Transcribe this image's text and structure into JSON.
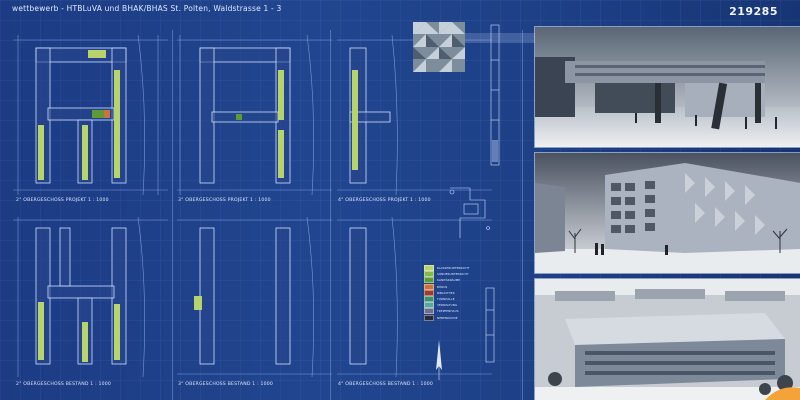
{
  "header": {
    "title": "wettbewerb - HTBLuVA und BHAK/BHAS St. Polten, Waldstrasse 1 - 3",
    "code": "219285"
  },
  "plans": [
    {
      "caption": "2° OBERGESCHOSS  PROJEKT     1 : 1000"
    },
    {
      "caption": "3° OBERGESCHOSS  PROJEKT     1 : 1000"
    },
    {
      "caption": "4° OBERGESCHOSS  PROJEKT     1 : 1000"
    },
    {
      "caption": "2° OBERGESCHOSS  BESTAND     1 : 1000"
    },
    {
      "caption": "3° OBERGESCHOSS  BESTAND     1 : 1000"
    },
    {
      "caption": "4° OBERGESCHOSS  BESTAND     1 : 1000"
    }
  ],
  "legend": {
    "items": [
      {
        "label": "KLASSENUNTERRICHT",
        "color": "#b7d36b"
      },
      {
        "label": "SONDERUNTERRICHT",
        "color": "#86b84d"
      },
      {
        "label": "SANITÄRRÄUME",
        "color": "#5f9a3a"
      },
      {
        "label": "BÜROS",
        "color": "#c8743a"
      },
      {
        "label": "BIBLIOTHEK",
        "color": "#9c3b2e"
      },
      {
        "label": "TURNHALLE",
        "color": "#3f8f6a"
      },
      {
        "label": "VERWALTUNG",
        "color": "#58a8a0"
      },
      {
        "label": "TREPPENHAUS",
        "color": "#6e6e8e"
      },
      {
        "label": "NEBENRÄUME",
        "color": "#2a2a3a"
      }
    ]
  },
  "colors": {
    "background": "#1e3f8a",
    "lines": "#9fc0ff",
    "accent_green": "#b7d36b",
    "accent_orange": "#f2a33a"
  }
}
